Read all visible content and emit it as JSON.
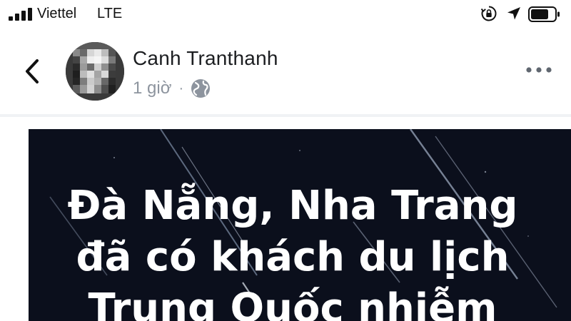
{
  "status_bar": {
    "carrier": "Viettel",
    "network": "LTE",
    "icons": [
      "signal-bars-icon",
      "rotation-lock-icon",
      "location-arrow-icon",
      "battery-icon"
    ]
  },
  "post": {
    "author": "Canh Tranthanh",
    "time": "1 giờ",
    "separator": "·",
    "privacy_icon": "globe-icon",
    "image_text": [
      "Đà Nẵng, Nha Trang",
      "đã có khách du lịch",
      "Trung Quốc nhiễm"
    ]
  },
  "colors": {
    "image_background": "#0b0f1c",
    "meta_text": "#8d949e",
    "name_text": "#1c1e21"
  }
}
